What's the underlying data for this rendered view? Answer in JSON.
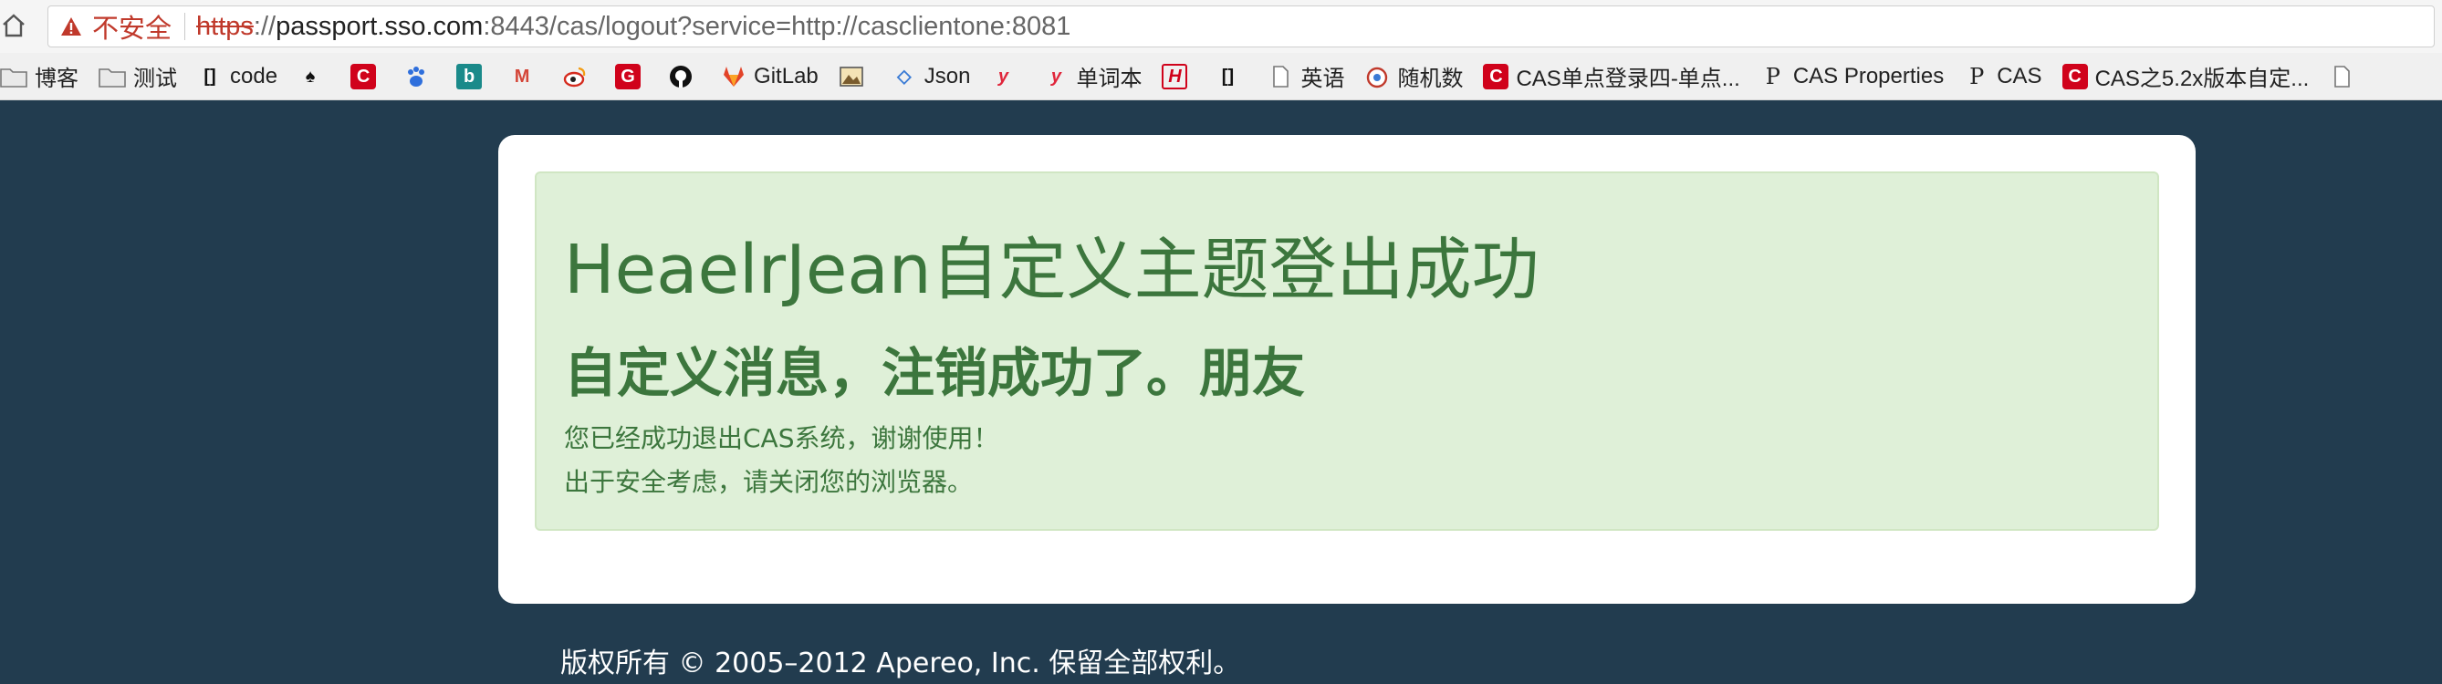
{
  "addressbar": {
    "security_label": "不安全",
    "url_scheme": "https",
    "url_scheme_rest": "://",
    "url_host": "passport.sso.com",
    "url_path": ":8443/cas/logout?service=http://casclientone:8081"
  },
  "bookmarks": [
    {
      "label": "博客",
      "icon": "folder-icon"
    },
    {
      "label": "测试",
      "icon": "folder-icon"
    },
    {
      "label": "code",
      "icon": "link-icon"
    },
    {
      "label": "",
      "icon": "spade-icon"
    },
    {
      "label": "",
      "icon": "csdn-icon"
    },
    {
      "label": "",
      "icon": "baidu-paw-icon"
    },
    {
      "label": "",
      "icon": "bing-icon"
    },
    {
      "label": "",
      "icon": "gmail-icon"
    },
    {
      "label": "",
      "icon": "weibo-icon"
    },
    {
      "label": "",
      "icon": "g-icon"
    },
    {
      "label": "",
      "icon": "github-icon"
    },
    {
      "label": "GitLab",
      "icon": "gitlab-icon"
    },
    {
      "label": "",
      "icon": "image-icon"
    },
    {
      "label": "Json",
      "icon": "json-icon"
    },
    {
      "label": "",
      "icon": "youdao-icon"
    },
    {
      "label": "单词本",
      "icon": "youdao-icon"
    },
    {
      "label": "",
      "icon": "h-icon"
    },
    {
      "label": "",
      "icon": "link-icon"
    },
    {
      "label": "英语",
      "icon": "page-icon"
    },
    {
      "label": "随机数",
      "icon": "random-icon"
    },
    {
      "label": "CAS单点登录四-单点...",
      "icon": "csdn-icon"
    },
    {
      "label": "CAS Properties",
      "icon": "p-icon"
    },
    {
      "label": "CAS",
      "icon": "p-icon"
    },
    {
      "label": "CAS之5.2x版本自定...",
      "icon": "csdn-icon"
    },
    {
      "label": "",
      "icon": "page-icon"
    }
  ],
  "alert": {
    "title": "HeaelrJean自定义主题登出成功",
    "subtitle": "自定义消息，注销成功了。朋友",
    "line1": "您已经成功退出CAS系统，谢谢使用！",
    "line2": "出于安全考虑，请关闭您的浏览器。"
  },
  "footer": {
    "copyright": "版权所有 © 2005–2012 Apereo, Inc. 保留全部权利。"
  },
  "colors": {
    "page_background": "#223c4f",
    "alert_background": "#dff0d8",
    "alert_text": "#3c763d",
    "warning": "#c0392b"
  }
}
